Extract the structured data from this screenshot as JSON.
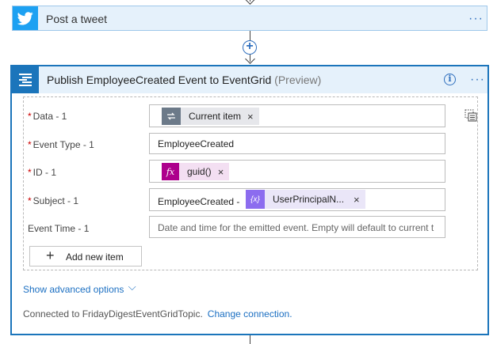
{
  "tweet_step": {
    "title": "Post a tweet",
    "menu": "···",
    "icon": "twitter-bird-icon",
    "color": "#1da1f2"
  },
  "add_step": {
    "symbol": "+"
  },
  "eventgrid_step": {
    "title": "Publish EmployeeCreated Event to EventGrid",
    "badge": "(Preview)",
    "info": "i",
    "menu": "···",
    "icon": "eventgrid-icon",
    "color": "#1b75bb"
  },
  "fields": {
    "data": {
      "required": "*",
      "label": "Data - 1",
      "token": "Current item",
      "token_close": "×"
    },
    "event_type": {
      "required": "*",
      "label": "Event Type - 1",
      "value": "EmployeeCreated"
    },
    "id": {
      "required": "*",
      "label": "ID - 1",
      "fx": "fx",
      "token": "guid()",
      "token_close": "×"
    },
    "subject": {
      "required": "*",
      "label": "Subject - 1",
      "prefix": "EmployeeCreated - ",
      "token_icon": "{x}",
      "token": "UserPrincipalN...",
      "token_close": "×"
    },
    "event_time": {
      "label": "Event Time - 1",
      "placeholder": "Date and time for the emitted event. Empty will default to current t"
    }
  },
  "add_new_item": {
    "plus": "+",
    "label": "Add new item"
  },
  "advanced": {
    "label": "Show advanced options",
    "chevron": "⌵"
  },
  "connection": {
    "text": "Connected to FridayDigestEventGridTopic.",
    "link": "Change connection."
  }
}
